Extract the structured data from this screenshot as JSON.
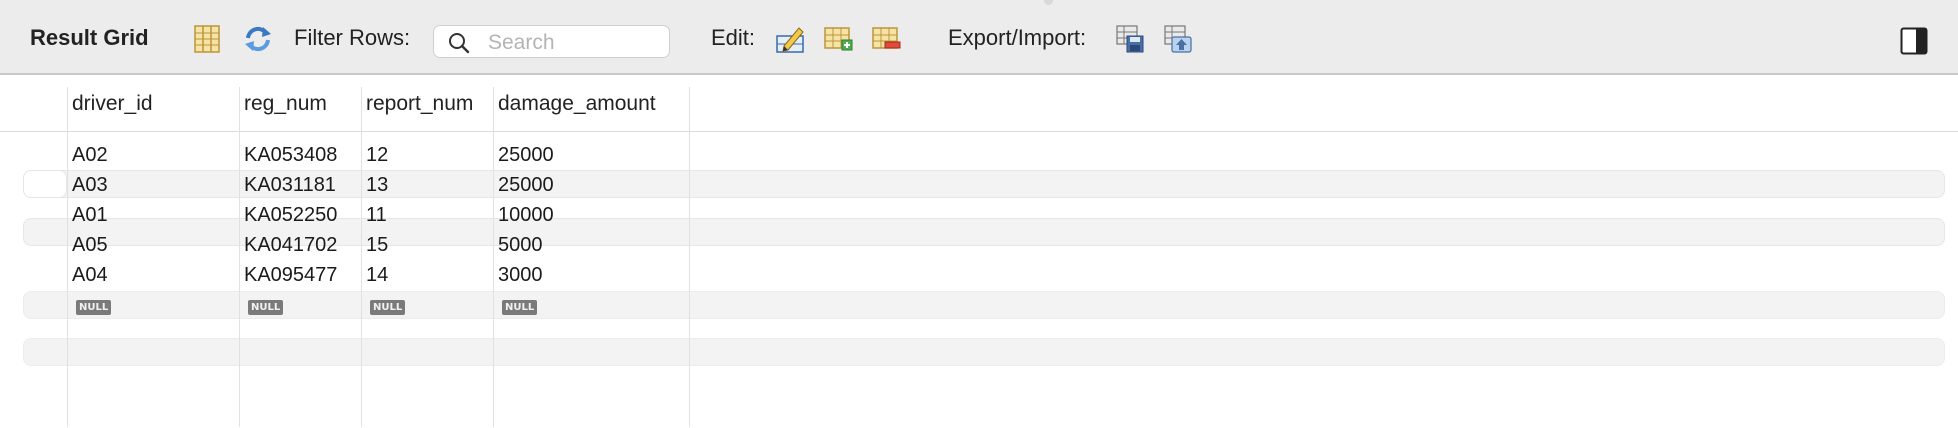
{
  "toolbar": {
    "title": "Result Grid",
    "filter_label": "Filter Rows:",
    "search_placeholder": "Search",
    "edit_label": "Edit:",
    "export_label": "Export/Import:"
  },
  "icons": {
    "column_toggle": "column-layout-icon",
    "refresh": "refresh-icon",
    "search": "search-icon",
    "edit_row": "edit-row-icon",
    "add_row": "add-row-icon",
    "delete_row": "delete-row-icon",
    "export": "export-icon",
    "import": "import-icon",
    "panel": "side-panel-icon"
  },
  "colors": {
    "toolbar_bg": "#ececec",
    "stripe_bg": "#f3f3f3",
    "null_badge": "#7a7a7a",
    "icon_blue": "#3a7ac4",
    "icon_yellow": "#f2c94c"
  },
  "grid": {
    "columns": [
      "driver_id",
      "reg_num",
      "report_num",
      "damage_amount"
    ],
    "rows": [
      [
        "A02",
        "KA053408",
        "12",
        "25000"
      ],
      [
        "A03",
        "KA031181",
        "13",
        "25000"
      ],
      [
        "A01",
        "KA052250",
        "11",
        "10000"
      ],
      [
        "A05",
        "KA041702",
        "15",
        "5000"
      ],
      [
        "A04",
        "KA095477",
        "14",
        "3000"
      ]
    ],
    "null_label": "NULL"
  }
}
